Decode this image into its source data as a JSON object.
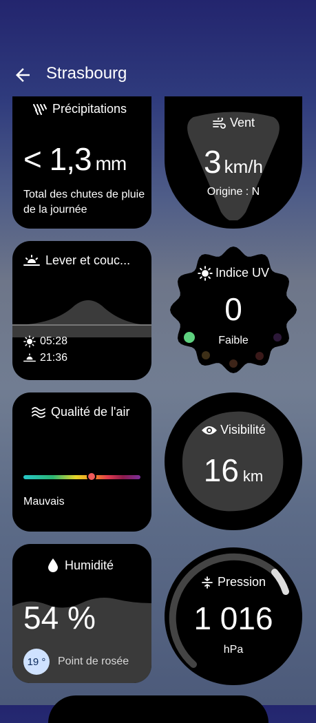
{
  "header": {
    "title": "Strasbourg"
  },
  "precipitation": {
    "label": "Précipitations",
    "value": "< 1,3",
    "unit": "mm",
    "description": "Total des chutes de pluie de la journée"
  },
  "wind": {
    "label": "Vent",
    "value": "3",
    "unit": "km/h",
    "origin": "Origine : N"
  },
  "sunrise_sunset": {
    "label": "Lever et couc...",
    "sunrise": "05:28",
    "sunset": "21:36"
  },
  "uv": {
    "label": "Indice UV",
    "value": "0",
    "level": "Faible"
  },
  "air_quality": {
    "label": "Qualité de l'air",
    "level": "Mauvais",
    "marker_fraction": 0.58
  },
  "visibility": {
    "label": "Visibilité",
    "value": "16",
    "unit": "km"
  },
  "humidity": {
    "label": "Humidité",
    "value": "54 %",
    "dew_point": "19 °",
    "dew_label": "Point de rosée"
  },
  "pressure": {
    "label": "Pression",
    "value": "1 016",
    "unit": "hPa"
  }
}
